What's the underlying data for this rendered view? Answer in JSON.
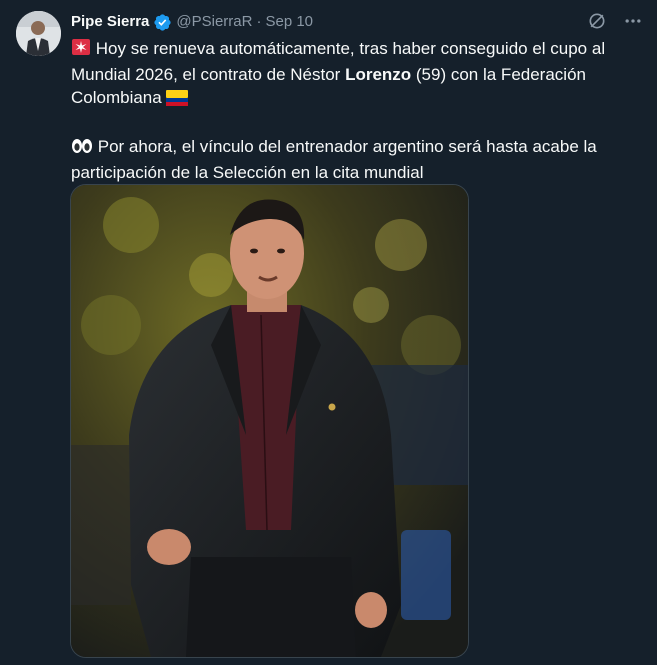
{
  "author": {
    "name": "Pipe Sierra",
    "handle": "@PSierraR",
    "separator": "·",
    "date": "Sep 10"
  },
  "tweet": {
    "para1": {
      "part1": "Hoy se renueva automáticamente, tras haber conseguido el cupo al Mundial 2026, el contrato de Néstor ",
      "bold": "Lorenzo",
      "part2": " (59) con la Federación Colombiana"
    },
    "para2": {
      "text": "Por ahora, el vínculo del entrenador argentino será hasta acabe la participación de la Selección en la cita mundial"
    }
  },
  "icons": {
    "verified": "verified-badge-icon",
    "grok": "grok-icon",
    "more": "more-options-icon",
    "siren": "siren-emoji",
    "eyes": "eyes-emoji",
    "flag": "colombia-flag-emoji"
  },
  "colors": {
    "background": "#15202b",
    "text": "#f7f9f9",
    "secondary": "#8b98a5",
    "verified": "#1d9bf0"
  }
}
